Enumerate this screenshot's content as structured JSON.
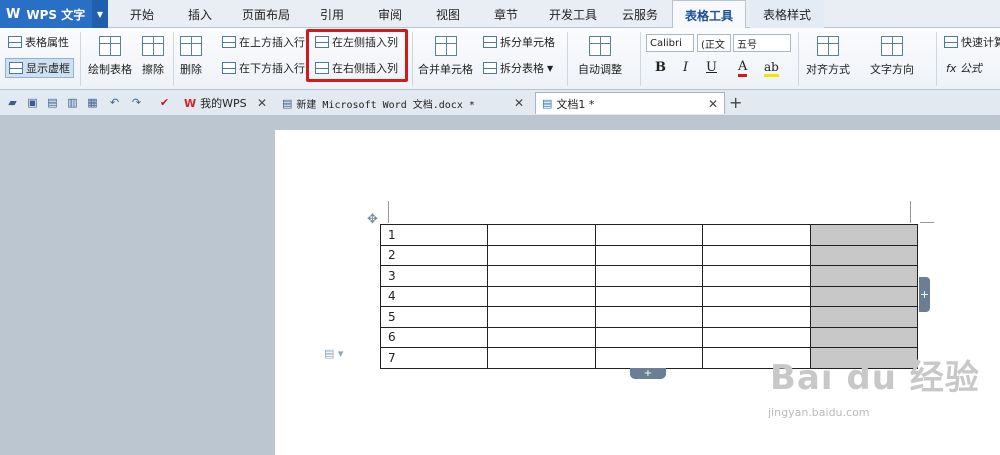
{
  "app": {
    "logo": "W",
    "title": "WPS 文字"
  },
  "menu": {
    "tabs": [
      {
        "label": "开始"
      },
      {
        "label": "插入"
      },
      {
        "label": "页面布局"
      },
      {
        "label": "引用"
      },
      {
        "label": "审阅"
      },
      {
        "label": "视图"
      },
      {
        "label": "章节"
      },
      {
        "label": "开发工具"
      },
      {
        "label": "云服务"
      },
      {
        "label": "表格工具"
      },
      {
        "label": "表格样式"
      }
    ],
    "active": "表格工具"
  },
  "ribbon": {
    "table_props": "表格属性",
    "show_grid": "显示虚框",
    "draw_table": "绘制表格",
    "erase": "擦除",
    "delete": "删除",
    "insert_row_above": "在上方插入行",
    "insert_row_below": "在下方插入行",
    "insert_col_left": "在左侧插入列",
    "insert_col_right": "在右侧插入列",
    "merge_cells": "合并单元格",
    "split_cells": "拆分单元格",
    "split_table": "拆分表格",
    "autofit": "自动调整",
    "font_name": "Calibri",
    "font_style": "(正文",
    "font_size": "五号",
    "bold": "B",
    "italic": "I",
    "underline": "U",
    "font_color": "A",
    "align": "对齐方式",
    "text_direction": "文字方向",
    "quick_calc": "快速计算",
    "formula": "fx 公式"
  },
  "doc_tabs": [
    {
      "label": "我的WPS"
    },
    {
      "label": "新建 Microsoft Word 文档.docx *"
    },
    {
      "label": "文档1 *"
    }
  ],
  "table": {
    "rows": [
      "1",
      "2",
      "3",
      "4",
      "5",
      "6",
      "7"
    ]
  },
  "controls": {
    "add_row": "+",
    "add_col": "+",
    "move": "✥"
  },
  "watermark": {
    "line1": "Bai du 经验",
    "line2": "jingyan.baidu.com"
  }
}
